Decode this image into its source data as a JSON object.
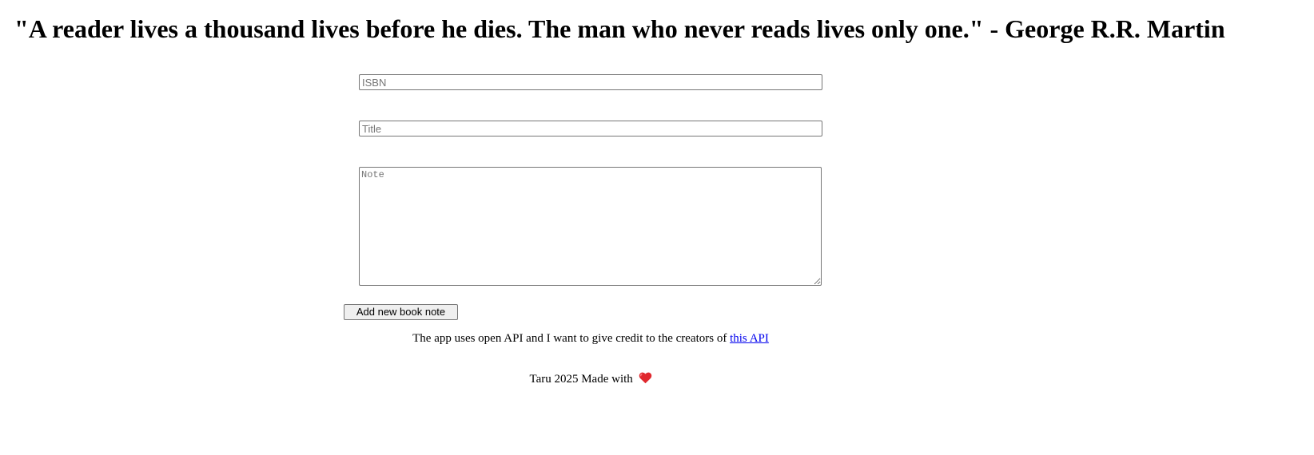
{
  "header": {
    "quote": "\"A reader lives a thousand lives before he dies. The man who never reads lives only one.\" - George R.R. Martin"
  },
  "form": {
    "isbn_placeholder": "ISBN",
    "title_placeholder": "Title",
    "note_placeholder": "Note",
    "submit_label": "Add new book note"
  },
  "credit": {
    "text": "The app uses open API and I want to give credit to the creators of ",
    "link_label": "this API"
  },
  "footer": {
    "text": "Taru 2025 Made with",
    "icon": "heart-icon",
    "icon_color": "#e0282e"
  }
}
